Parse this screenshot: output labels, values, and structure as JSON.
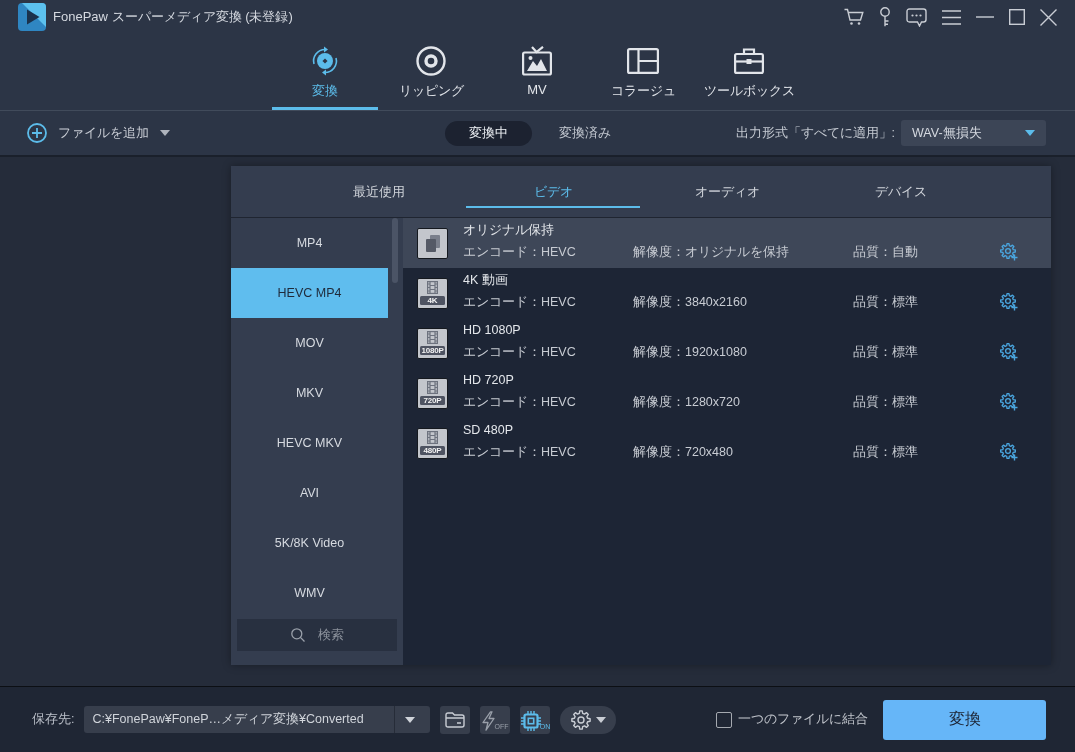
{
  "window": {
    "title": "FonePaw スーパーメディア変換 (未登録)"
  },
  "nav_tabs": [
    {
      "kind": "convert",
      "label": "変換",
      "selected": true
    },
    {
      "kind": "ripper",
      "label": "リッピング",
      "selected": false
    },
    {
      "kind": "mv",
      "label": "MV",
      "selected": false
    },
    {
      "kind": "collage",
      "label": "コラージュ",
      "selected": false
    },
    {
      "kind": "toolbox",
      "label": "ツールボックス",
      "selected": false
    }
  ],
  "toolbar": {
    "add_file": "ファイルを追加",
    "segments": [
      {
        "label": "変換中",
        "selected": true
      },
      {
        "label": "変換済み",
        "selected": false
      }
    ],
    "output_label": "出力形式「すべてに適用」:",
    "output_value": "WAV-無損失"
  },
  "format_panel": {
    "tabs": [
      {
        "label": "最近使用",
        "selected": false
      },
      {
        "label": "ビデオ",
        "selected": true
      },
      {
        "label": "オーディオ",
        "selected": false
      },
      {
        "label": "デバイス",
        "selected": false
      }
    ],
    "formats": [
      {
        "label": "MP4",
        "selected": false
      },
      {
        "label": "HEVC MP4",
        "selected": true
      },
      {
        "label": "MOV",
        "selected": false
      },
      {
        "label": "MKV",
        "selected": false
      },
      {
        "label": "HEVC MKV",
        "selected": false
      },
      {
        "label": "AVI",
        "selected": false
      },
      {
        "label": "5K/8K Video",
        "selected": false
      },
      {
        "label": "WMV",
        "selected": false
      }
    ],
    "search": {
      "placeholder": "検索"
    },
    "presets": [
      {
        "kind": "original",
        "title": "オリジナル保持",
        "encoder": "エンコード：HEVC",
        "resolution": "解像度：オリジナルを保持",
        "quality": "品質：自動",
        "selected": true
      },
      {
        "kind": "video",
        "badge": "4K",
        "title": "4K 動画",
        "encoder": "エンコード：HEVC",
        "resolution": "解像度：3840x2160",
        "quality": "品質：標準",
        "selected": false
      },
      {
        "kind": "video",
        "badge": "1080P",
        "title": "HD 1080P",
        "encoder": "エンコード：HEVC",
        "resolution": "解像度：1920x1080",
        "quality": "品質：標準",
        "selected": false
      },
      {
        "kind": "video",
        "badge": "720P",
        "title": "HD 720P",
        "encoder": "エンコード：HEVC",
        "resolution": "解像度：1280x720",
        "quality": "品質：標準",
        "selected": false
      },
      {
        "kind": "video",
        "badge": "480P",
        "title": "SD 480P",
        "encoder": "エンコード：HEVC",
        "resolution": "解像度：720x480",
        "quality": "品質：標準",
        "selected": false
      }
    ]
  },
  "bottom_bar": {
    "save_label": "保存先:",
    "path": "C:¥FonePaw¥FoneP…メディア変換¥Converted",
    "speed_toggle": {
      "label": "OFF",
      "on": false
    },
    "gpu_toggle": {
      "label": "ON",
      "on": true
    },
    "merge": {
      "label": "一つのファイルに結合",
      "checked": false
    },
    "convert_button": "変換"
  }
}
